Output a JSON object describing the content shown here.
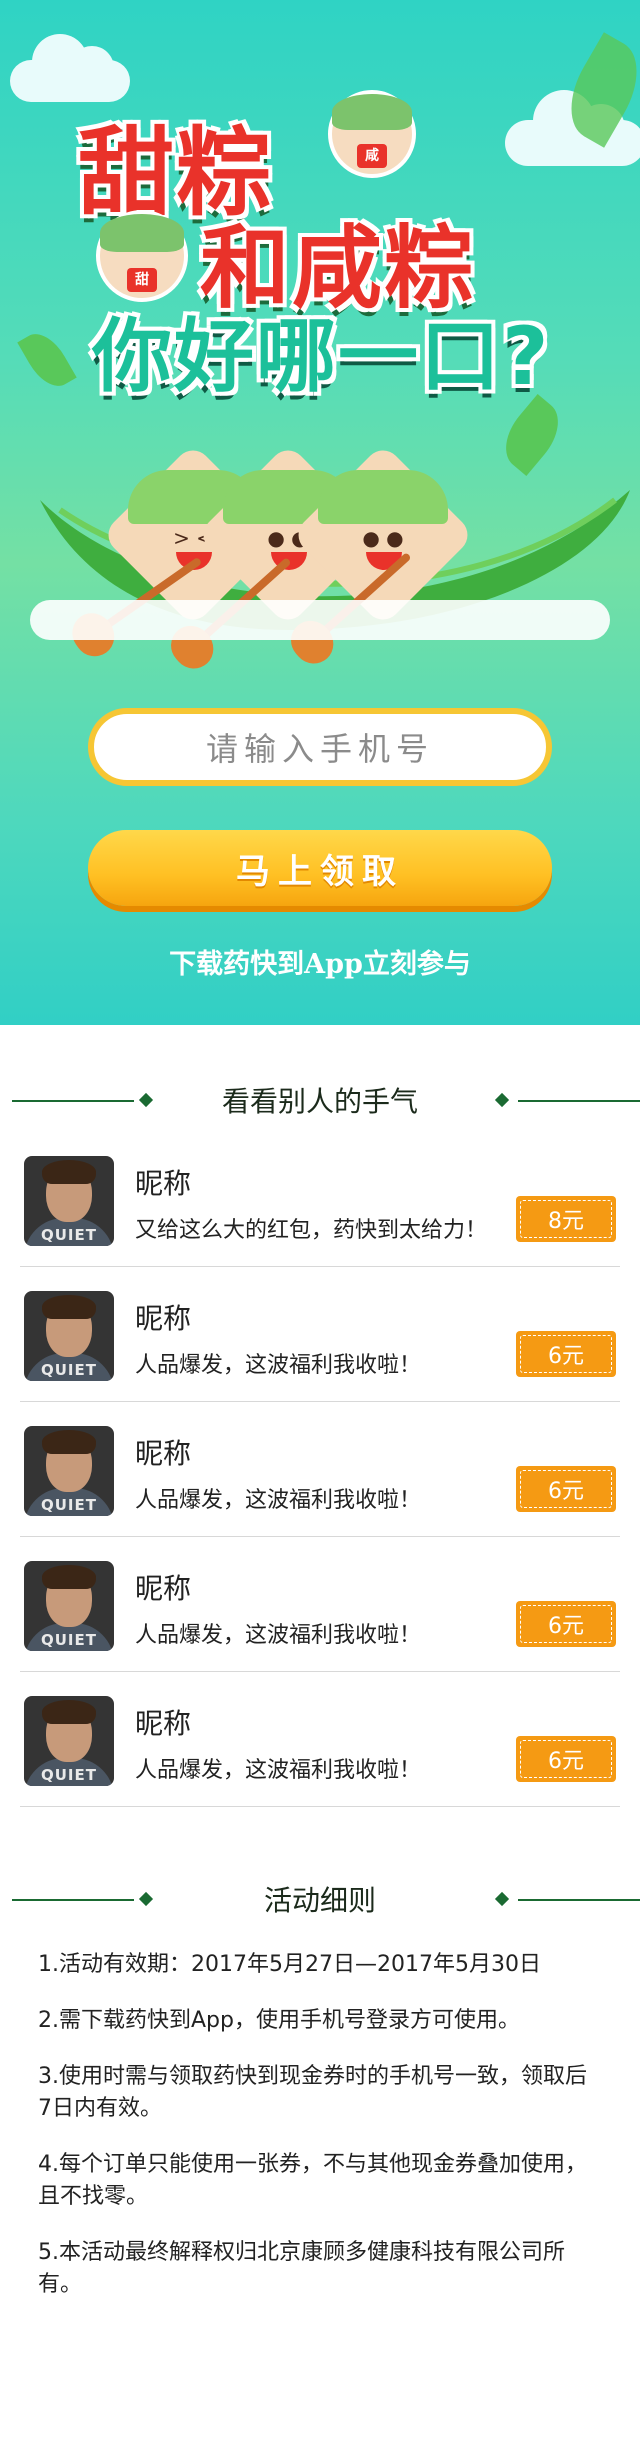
{
  "hero": {
    "title_line1": "甜粽",
    "title_line2": "和咸粽",
    "title_line3": "你好哪一口?",
    "tag_sweet": "甜",
    "tag_salty": "咸",
    "phone_placeholder": "请输入手机号",
    "claim_button": "马上领取",
    "download_hint": "下载药快到App立刻参与"
  },
  "records": {
    "heading": "看看别人的手气",
    "items": [
      {
        "nickname": "昵称",
        "message": "又给这么大的红包，药快到太给力！",
        "amount": "8元",
        "shirt_text": "QUIET"
      },
      {
        "nickname": "昵称",
        "message": "人品爆发，这波福利我收啦！",
        "amount": "6元",
        "shirt_text": "QUIET"
      },
      {
        "nickname": "昵称",
        "message": "人品爆发，这波福利我收啦！",
        "amount": "6元",
        "shirt_text": "QUIET"
      },
      {
        "nickname": "昵称",
        "message": "人品爆发，这波福利我收啦！",
        "amount": "6元",
        "shirt_text": "QUIET"
      },
      {
        "nickname": "昵称",
        "message": "人品爆发，这波福利我收啦！",
        "amount": "6元",
        "shirt_text": "QUIET"
      }
    ]
  },
  "rules": {
    "heading": "活动细则",
    "items": [
      "1.活动有效期：2017年5月27日—2017年5月30日",
      "2.需下载药快到App，使用手机号登录方可使用。",
      "3.使用时需与领取药快到现金券时的手机号一致，领取后7日内有效。",
      "4.每个订单只能使用一张券，不与其他现金券叠加使用，且不找零。",
      "5.本活动最终解释权归北京康顾多健康科技有限公司所有。"
    ]
  },
  "colors": {
    "hero_top": "#2fd3c4",
    "title_red": "#e9322a",
    "title_green": "#1cc09a",
    "button_yellow": "#ffc023",
    "coupon_orange": "#f59a13",
    "divider_green": "#1a6a32"
  }
}
